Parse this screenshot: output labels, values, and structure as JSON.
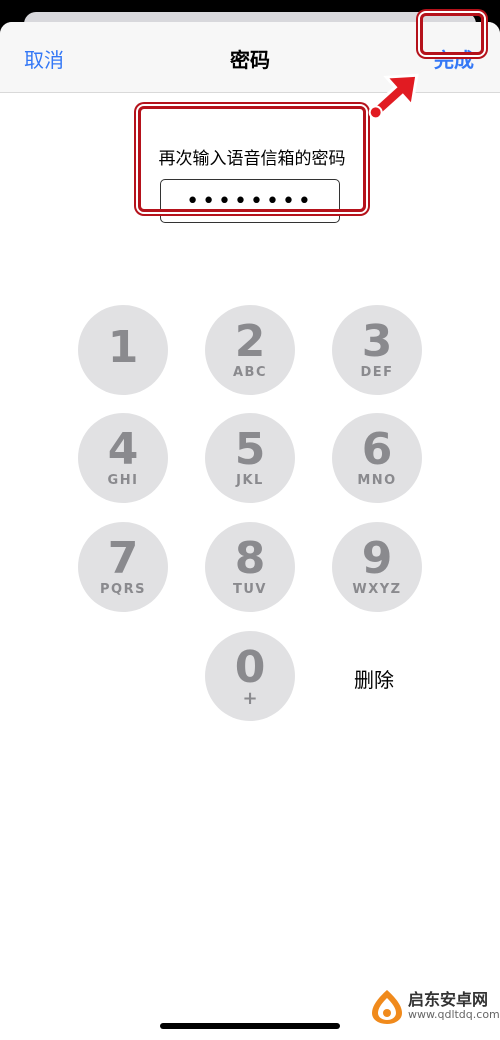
{
  "navbar": {
    "cancel_label": "取消",
    "title": "密码",
    "done_label": "完成"
  },
  "prompt": {
    "text": "再次输入语音信箱的密码",
    "masked_value": "••••••••"
  },
  "keypad": {
    "keys": [
      {
        "digit": "1",
        "letters": ""
      },
      {
        "digit": "2",
        "letters": "ABC"
      },
      {
        "digit": "3",
        "letters": "DEF"
      },
      {
        "digit": "4",
        "letters": "GHI"
      },
      {
        "digit": "5",
        "letters": "JKL"
      },
      {
        "digit": "6",
        "letters": "MNO"
      },
      {
        "digit": "7",
        "letters": "PQRS"
      },
      {
        "digit": "8",
        "letters": "TUV"
      },
      {
        "digit": "9",
        "letters": "WXYZ"
      },
      {
        "digit": "0",
        "letters": "+"
      }
    ],
    "delete_label": "删除"
  },
  "watermark": {
    "brand": "启东安卓网",
    "url": "www.qdltdq.com"
  },
  "colors": {
    "accent": "#3478f6",
    "annotation_red": "#b5121b",
    "key_bg": "#e1e1e3",
    "key_text": "#8a8a8e"
  },
  "icons": {
    "annotation": "red-arrow-icon",
    "watermark": "watermark-logo-icon"
  }
}
